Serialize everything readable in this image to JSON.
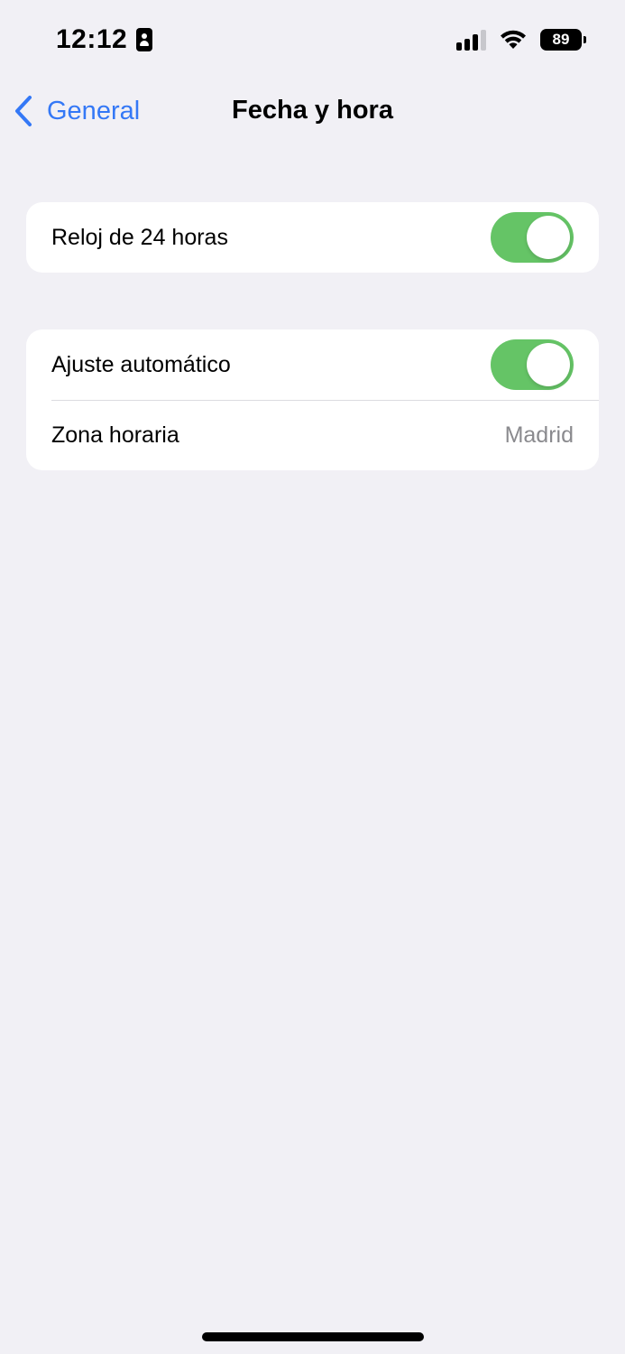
{
  "status_bar": {
    "time": "12:12",
    "focus_icon": "person-card-icon",
    "signal_icon": "cellular-signal-icon",
    "wifi_icon": "wifi-icon",
    "battery_level": "89"
  },
  "nav": {
    "back_label": "General",
    "back_icon": "chevron-left-icon",
    "title": "Fecha y hora"
  },
  "groups": [
    {
      "rows": [
        {
          "label": "Reloj de 24 horas",
          "type": "toggle",
          "on": true
        }
      ]
    },
    {
      "rows": [
        {
          "label": "Ajuste automático",
          "type": "toggle",
          "on": true
        },
        {
          "label": "Zona horaria",
          "type": "value",
          "value": "Madrid"
        }
      ]
    }
  ],
  "colors": {
    "background": "#f1f0f5",
    "accent": "#3478f6",
    "toggle_on": "#65c466",
    "secondary_text": "#8a8a8e"
  }
}
